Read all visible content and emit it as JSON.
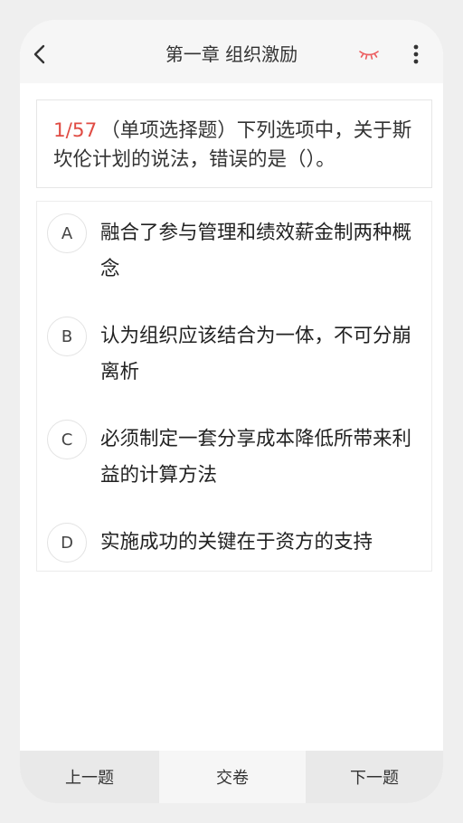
{
  "header": {
    "back_icon": "chevron-left-icon",
    "title": "第一章 组织激励",
    "hide_answer_icon": "closed-eye-icon",
    "menu_icon": "more-vertical-icon"
  },
  "question": {
    "index": "1/57",
    "type_label": "（单项选择题）",
    "text": "下列选项中，关于斯坎伦计划的说法，错误的是（）。"
  },
  "options": [
    {
      "letter": "A",
      "text": "融合了参与管理和绩效薪金制两种概念"
    },
    {
      "letter": "B",
      "text": "认为组织应该结合为一体，不可分崩离析"
    },
    {
      "letter": "C",
      "text": "必须制定一套分享成本降低所带来利益的计算方法"
    },
    {
      "letter": "D",
      "text": "实施成功的关键在于资方的支持"
    }
  ],
  "footer": {
    "prev_label": "上一题",
    "submit_label": "交卷",
    "next_label": "下一题"
  },
  "colors": {
    "accent": "#e04c44",
    "eye": "#ec5b5d",
    "text": "#333333",
    "bar_button": "#e9e9e9",
    "bar_button_light": "#f6f6f6"
  }
}
